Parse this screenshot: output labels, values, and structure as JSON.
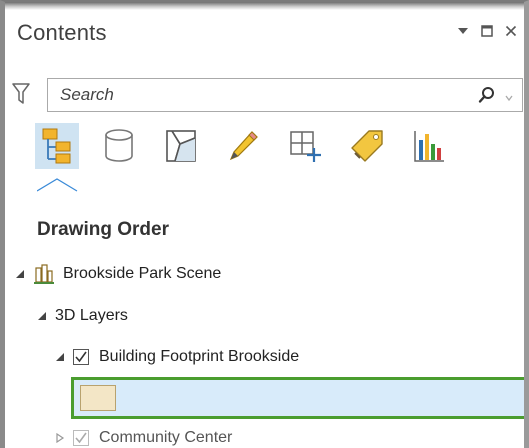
{
  "pane": {
    "title": "Contents",
    "controls": [
      "dropdown-caret-icon",
      "maximize-icon",
      "close-icon"
    ]
  },
  "search": {
    "placeholder": "Search",
    "value": ""
  },
  "toolbar": {
    "tools": [
      {
        "icon": "list-by-drawing-order-icon",
        "active": true
      },
      {
        "icon": "list-by-data-source-icon",
        "active": false
      },
      {
        "icon": "list-by-selection-icon",
        "active": false
      },
      {
        "icon": "list-by-editing-icon",
        "active": false
      },
      {
        "icon": "list-by-snapping-icon",
        "active": false
      },
      {
        "icon": "list-by-labeling-icon",
        "active": false
      },
      {
        "icon": "list-by-charts-icon",
        "active": false
      }
    ]
  },
  "section": {
    "title": "Drawing Order"
  },
  "tree": {
    "scene": {
      "label": "Brookside Park Scene",
      "icon": "scene-icon",
      "expanded": true
    },
    "group": {
      "label": "3D Layers",
      "expanded": true
    },
    "layer": {
      "label": "Building Footprint Brookside",
      "checked": true,
      "expanded": true
    },
    "next_layer": {
      "label": "Community Center",
      "checked": true,
      "expanded": false
    }
  },
  "colors": {
    "selection_border": "#4a9d2f",
    "selection_fill": "#d8ebfa",
    "symbol_fill": "#f3e6c6",
    "active_tool_bg": "#cfe3f2"
  }
}
